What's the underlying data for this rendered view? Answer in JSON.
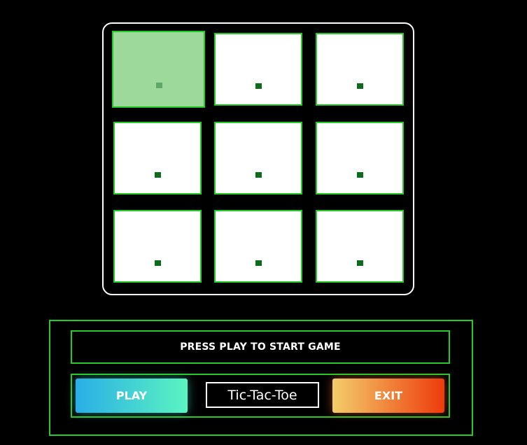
{
  "board": {
    "cells": [
      {
        "id": 1,
        "state": "hover"
      },
      {
        "id": 2,
        "state": "empty"
      },
      {
        "id": 3,
        "state": "empty"
      },
      {
        "id": 4,
        "state": "empty"
      },
      {
        "id": 5,
        "state": "empty"
      },
      {
        "id": 6,
        "state": "empty"
      },
      {
        "id": 7,
        "state": "empty"
      },
      {
        "id": 8,
        "state": "empty"
      },
      {
        "id": 9,
        "state": "empty"
      }
    ]
  },
  "status": {
    "message": "PRESS PLAY TO START GAME"
  },
  "controls": {
    "play_label": "PLAY",
    "title": "Tic-Tac-Toe",
    "exit_label": "EXIT"
  },
  "colors": {
    "accent_green": "#22cc22",
    "cell_bg": "#ffffff",
    "cell_hover_bg": "#9dd99b",
    "marker": "#0f6b1c",
    "play_gradient": [
      "#29aee6",
      "#5cf4c1"
    ],
    "exit_gradient": [
      "#f3cd6a",
      "#ee3b0c"
    ]
  }
}
